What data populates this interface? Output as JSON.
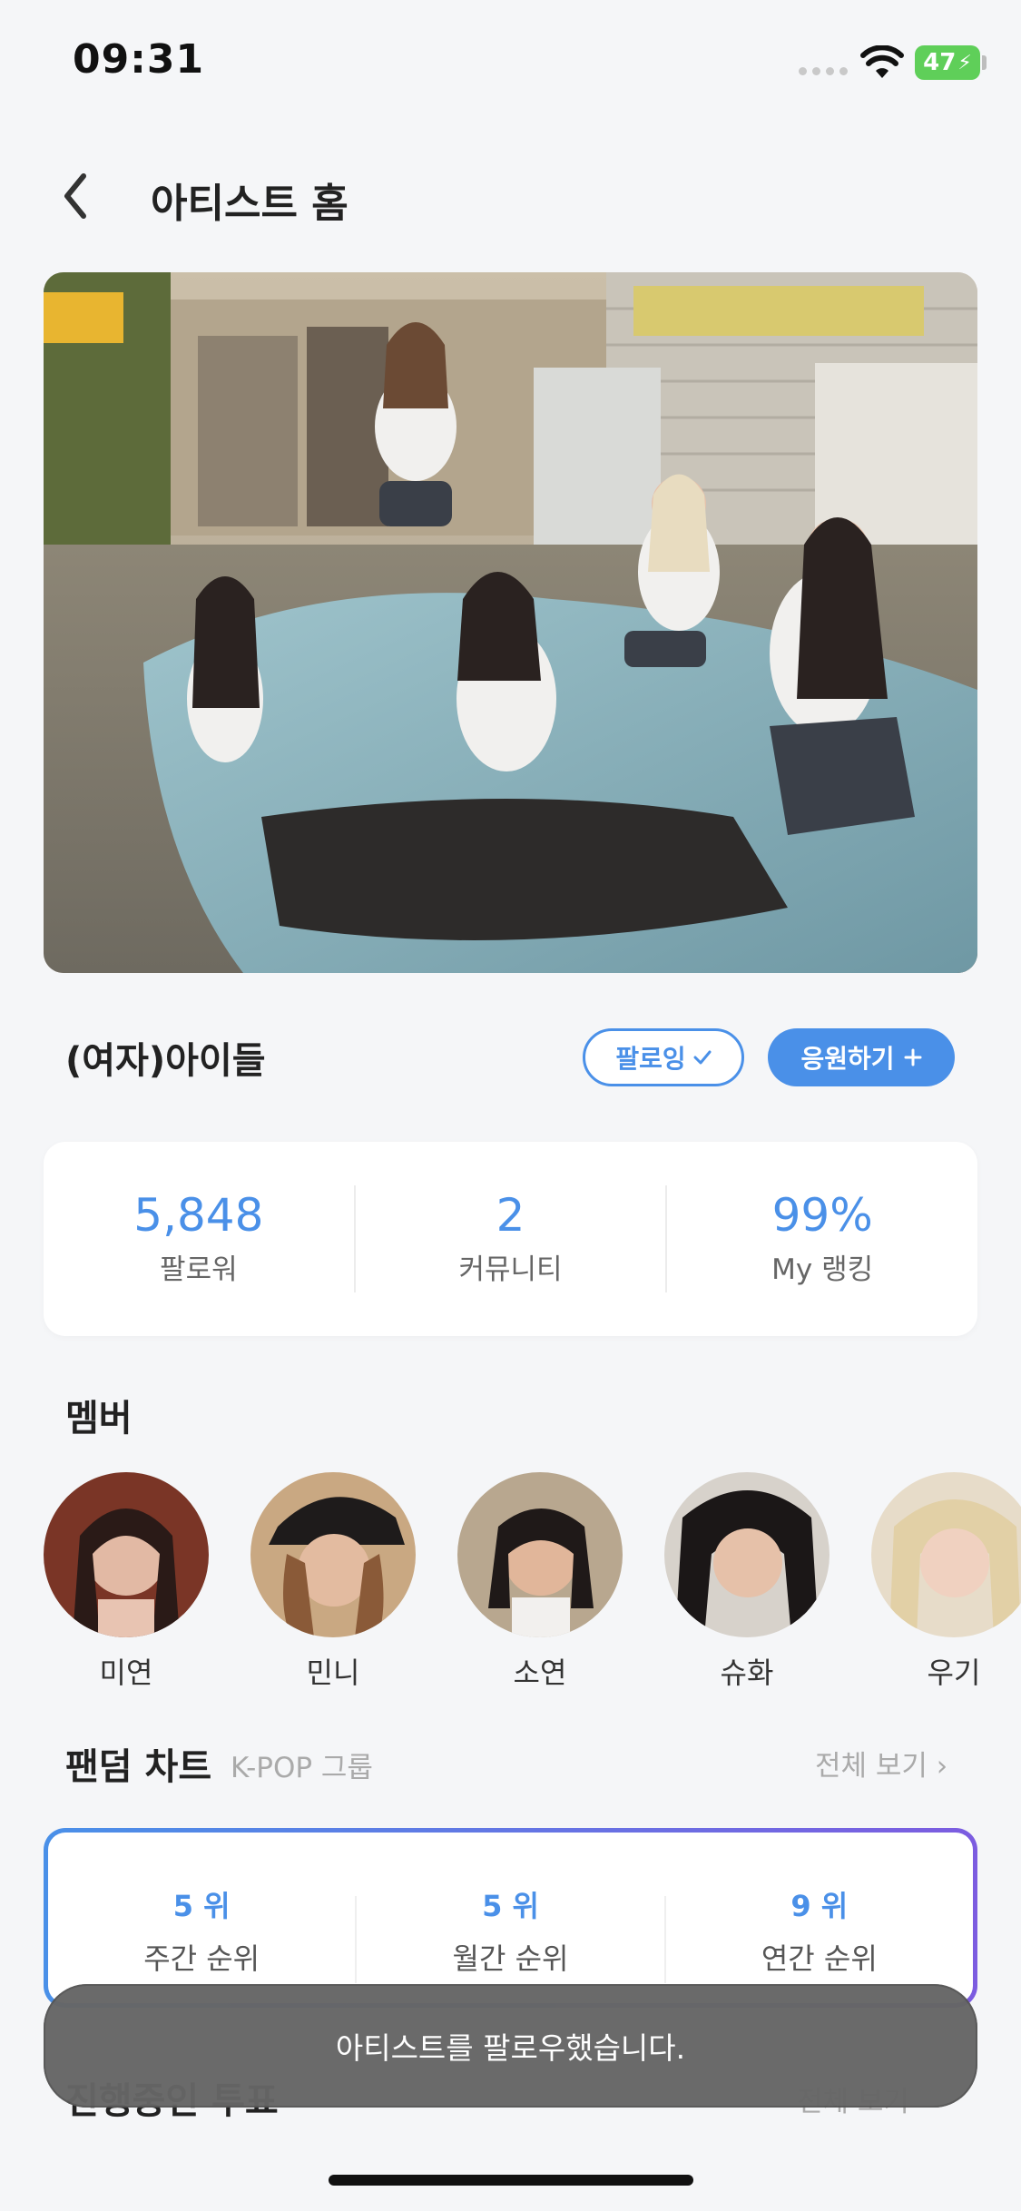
{
  "status_bar": {
    "time": "09:31",
    "battery": "47"
  },
  "header": {
    "title": "아티스트 홈"
  },
  "artist": {
    "name": "(여자)아이들",
    "follow_label": "팔로잉",
    "follow_icon": "check-icon",
    "support_label": "응원하기",
    "support_icon": "plus-icon"
  },
  "stats": [
    {
      "value": "5,848",
      "label": "팔로워"
    },
    {
      "value": "2",
      "label": "커뮤니티"
    },
    {
      "value": "99%",
      "label": "My 랭킹"
    }
  ],
  "members": {
    "title": "멤버",
    "items": [
      {
        "name": "미연"
      },
      {
        "name": "민니"
      },
      {
        "name": "소연"
      },
      {
        "name": "슈화"
      },
      {
        "name": "우기"
      }
    ]
  },
  "fandom_chart": {
    "title": "팬덤 차트",
    "subtitle": "K-POP 그룹",
    "view_all": "전체 보기",
    "ranks": [
      {
        "value": "5 위",
        "label": "주간 순위"
      },
      {
        "value": "5 위",
        "label": "월간 순위"
      },
      {
        "value": "9 위",
        "label": "연간 순위"
      }
    ]
  },
  "voting": {
    "title": "진행중인 투표",
    "more": "전체 보기"
  },
  "toast": {
    "message": "아티스트를 팔로우했습니다."
  },
  "colors": {
    "accent": "#4a90e8",
    "accent_end": "#7c5ce0",
    "background": "#f5f6f8",
    "toast": "#666666"
  }
}
